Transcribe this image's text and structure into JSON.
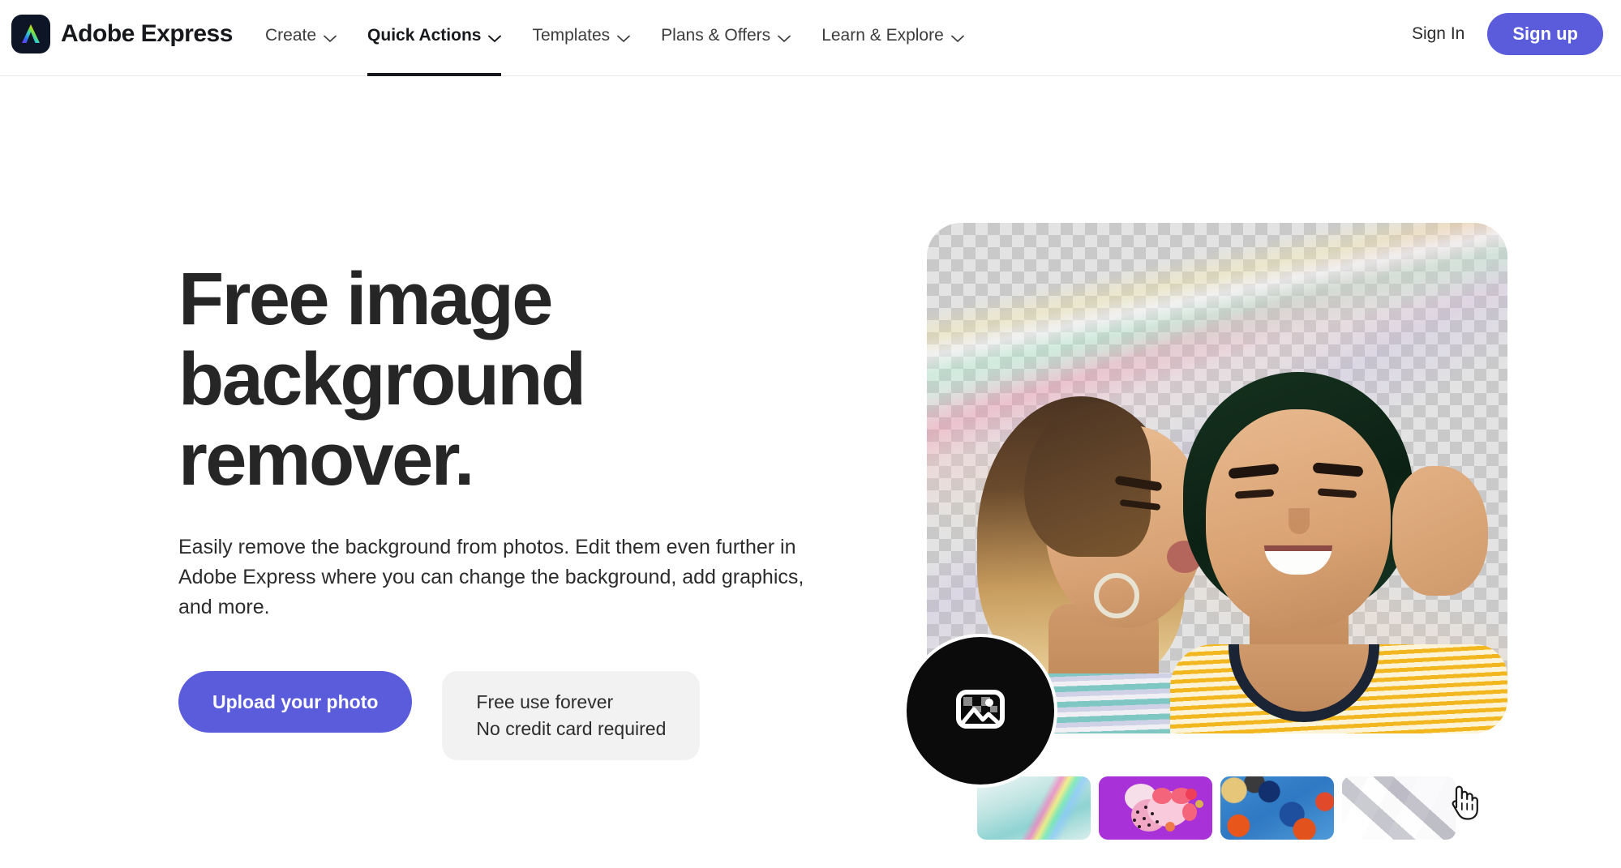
{
  "nav": {
    "brand": {
      "name": "Adobe Express",
      "logo_icon": "adobe-express-logo-icon"
    },
    "links": [
      {
        "label": "Create",
        "icon": "chevron-down-icon",
        "active": false
      },
      {
        "label": "Quick Actions",
        "icon": "chevron-down-icon",
        "active": true
      },
      {
        "label": "Templates",
        "icon": "chevron-down-icon",
        "active": false
      },
      {
        "label": "Plans & Offers",
        "icon": "chevron-down-icon",
        "active": false
      },
      {
        "label": "Learn & Explore",
        "icon": "chevron-down-icon",
        "active": false
      }
    ],
    "sign_in_label": "Sign In",
    "sign_up_label": "Sign up"
  },
  "hero": {
    "title": "Free image background remover.",
    "subtitle": "Easily remove the background from photos. Edit them even further in Adobe Express where you can change the background, add graphics, and more.",
    "upload_label": "Upload your photo",
    "free_line1": "Free use forever",
    "free_line2": "No credit card required"
  },
  "preview": {
    "picker_icon": "image-placeholder-icon",
    "thumbnails": [
      {
        "name": "thumbnail-holographic-teal",
        "selected": false
      },
      {
        "name": "thumbnail-purple-abstract",
        "selected": true
      },
      {
        "name": "thumbnail-blue-floral",
        "selected": false
      },
      {
        "name": "thumbnail-crystal-silver",
        "selected": false
      }
    ],
    "cursor_icon": "pointing-hand-cursor"
  },
  "colors": {
    "accent_purple": "#5a5cdc",
    "text_dark": "#16181c",
    "chip_bg": "#f2f2f2",
    "nav_border": "#e8e8e8"
  }
}
